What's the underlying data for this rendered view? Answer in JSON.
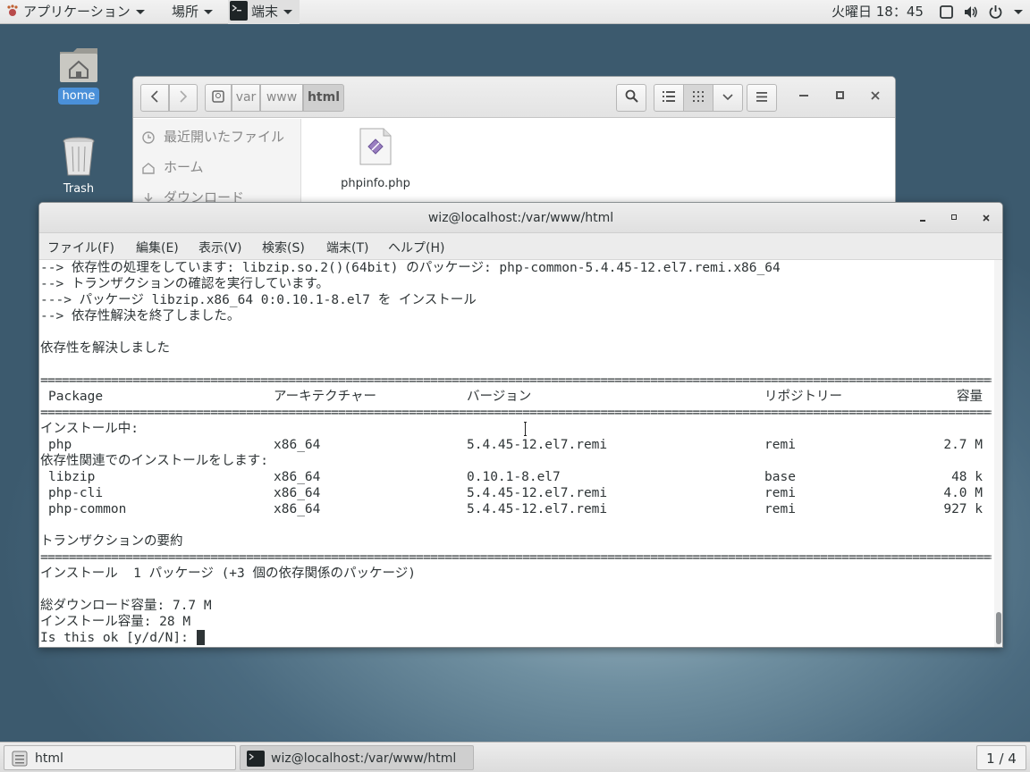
{
  "topbar": {
    "apps_label": "アプリケーション",
    "places_label": "場所",
    "terminal_label": "端末",
    "clock": "火曜日 18：45"
  },
  "desktop": {
    "home_label": "home",
    "trash_label": "Trash"
  },
  "filemanager": {
    "breadcrumbs": [
      "var",
      "www",
      "html"
    ],
    "sidebar": [
      "最近開いたファイル",
      "ホーム",
      "ダウンロード"
    ],
    "file_name": "phpinfo.php"
  },
  "terminal": {
    "title": "wiz@localhost:/var/www/html",
    "menu": [
      "ファイル(F)",
      "編集(E)",
      "表示(V)",
      "検索(S)",
      "端末(T)",
      "ヘルプ(H)"
    ],
    "lines_top": [
      "--> 依存性の処理をしています: libzip.so.2()(64bit) のパッケージ: php-common-5.4.45-12.el7.remi.x86_64",
      "--> トランザクションの確認を実行しています。",
      "---> パッケージ libzip.x86_64 0:0.10.1-8.el7 を インストール",
      "--> 依存性解決を終了しました。",
      "",
      "依存性を解決しました",
      ""
    ],
    "separator": "==================================================================================================================================================",
    "table_header": {
      "package": "Package",
      "arch": "アーキテクチャー",
      "version": "バージョン",
      "repo": "リポジトリー",
      "size": "容量"
    },
    "section_install": "インストール中:",
    "section_deps": "依存性関連でのインストールをします:",
    "install_rows": [
      {
        "package": "php",
        "arch": "x86_64",
        "version": "5.4.45-12.el7.remi",
        "repo": "remi",
        "size": "2.7 M"
      }
    ],
    "dep_rows": [
      {
        "package": "libzip",
        "arch": "x86_64",
        "version": "0.10.1-8.el7",
        "repo": "base",
        "size": "48 k"
      },
      {
        "package": "php-cli",
        "arch": "x86_64",
        "version": "5.4.45-12.el7.remi",
        "repo": "remi",
        "size": "4.0 M"
      },
      {
        "package": "php-common",
        "arch": "x86_64",
        "version": "5.4.45-12.el7.remi",
        "repo": "remi",
        "size": "927 k"
      }
    ],
    "summary_title": "トランザクションの要約",
    "summary_line": "インストール  1 パッケージ (+3 個の依存関係のパッケージ)",
    "download_size": "総ダウンロード容量: 7.7 M",
    "install_size": "インストール容量: 28 M",
    "prompt": "Is this ok [y/d/N]: "
  },
  "taskbar": {
    "task1": "html",
    "task2": "wiz@localhost:/var/www/html",
    "workspace": "1 / 4"
  },
  "colors": {
    "terminal_text": "#2e3436",
    "home_label_bg": "#4a90d9"
  }
}
